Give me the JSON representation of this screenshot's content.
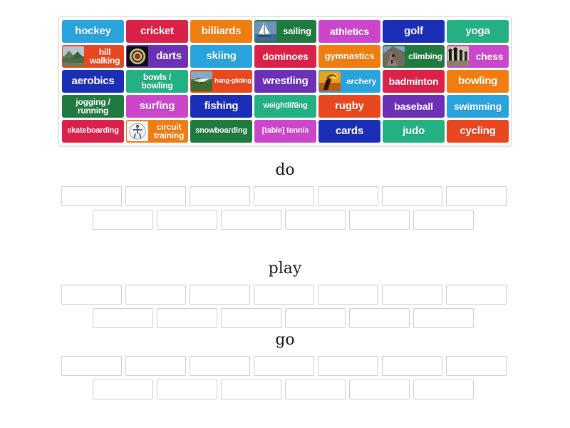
{
  "activity": {
    "type": "group-sort",
    "title_do": "do",
    "title_play": "play",
    "title_go": "go"
  },
  "tile_bank": {
    "rows": [
      [
        {
          "label": "hockey",
          "color": "#29a3dc",
          "size": "fs-15",
          "image": null
        },
        {
          "label": "cricket",
          "color": "#d9214a",
          "size": "fs-15",
          "image": null
        },
        {
          "label": "billiards",
          "color": "#f07d10",
          "size": "fs-15",
          "image": null
        },
        {
          "label": "sailing",
          "color": "#1f7a3f",
          "size": "fs-13",
          "image": "sailboat-photo"
        },
        {
          "label": "athletics",
          "color": "#cc46cc",
          "size": "fs-14",
          "image": null
        },
        {
          "label": "golf",
          "color": "#1a2fb5",
          "size": "fs-15",
          "image": null
        },
        {
          "label": "yoga",
          "color": "#23b082",
          "size": "fs-15",
          "image": null
        }
      ],
      [
        {
          "label": "hill walking",
          "color": "#e8471f",
          "size": "fs-12",
          "image": "hill-photo"
        },
        {
          "label": "darts",
          "color": "#6b30b5",
          "size": "fs-15",
          "image": "dartboard-photo"
        },
        {
          "label": "skiing",
          "color": "#29a3dc",
          "size": "fs-15",
          "image": null
        },
        {
          "label": "dominoes",
          "color": "#d9214a",
          "size": "fs-14",
          "image": null
        },
        {
          "label": "gymnastics",
          "color": "#f07d10",
          "size": "fs-13",
          "image": null
        },
        {
          "label": "climbing",
          "color": "#1f7a3f",
          "size": "fs-12",
          "image": "climber-photo"
        },
        {
          "label": "chess",
          "color": "#cc46cc",
          "size": "fs-14",
          "image": "chess-photo"
        }
      ],
      [
        {
          "label": "aerobics",
          "color": "#1a2fb5",
          "size": "fs-15",
          "image": null
        },
        {
          "label": "bowls / bowling",
          "color": "#23b082",
          "size": "fs-12",
          "image": null
        },
        {
          "label": "hang-gliding",
          "color": "#e8471f",
          "size": "fs-9",
          "image": "hangglider-photo"
        },
        {
          "label": "wrestling",
          "color": "#6b30b5",
          "size": "fs-15",
          "image": null
        },
        {
          "label": "archery",
          "color": "#29a3dc",
          "size": "fs-12",
          "image": "archery-photo"
        },
        {
          "label": "badminton",
          "color": "#d9214a",
          "size": "fs-14",
          "image": null
        },
        {
          "label": "bowling",
          "color": "#f07d10",
          "size": "fs-15",
          "image": null
        }
      ],
      [
        {
          "label": "jogging / running",
          "color": "#1f7a3f",
          "size": "fs-12",
          "image": null
        },
        {
          "label": "surfing",
          "color": "#cc46cc",
          "size": "fs-15",
          "image": null
        },
        {
          "label": "fishing",
          "color": "#1a2fb5",
          "size": "fs-15",
          "image": null
        },
        {
          "label": "weightlifting",
          "color": "#23b082",
          "size": "fs-11",
          "image": null
        },
        {
          "label": "rugby",
          "color": "#e8471f",
          "size": "fs-15",
          "image": null
        },
        {
          "label": "baseball",
          "color": "#6b30b5",
          "size": "fs-14",
          "image": null
        },
        {
          "label": "swimming",
          "color": "#29a3dc",
          "size": "fs-14",
          "image": null
        }
      ],
      [
        {
          "label": "skateboarding",
          "color": "#d9214a",
          "size": "fs-11",
          "image": null
        },
        {
          "label": "circuit training",
          "color": "#f07d10",
          "size": "fs-12",
          "image": "circuit-photo"
        },
        {
          "label": "snowboarding",
          "color": "#1f7a3f",
          "size": "fs-11",
          "image": null
        },
        {
          "label": "[table] tennis",
          "color": "#cc46cc",
          "size": "fs-11",
          "image": null
        },
        {
          "label": "cards",
          "color": "#1a2fb5",
          "size": "fs-15",
          "image": null
        },
        {
          "label": "judo",
          "color": "#23b082",
          "size": "fs-15",
          "image": null
        },
        {
          "label": "cycling",
          "color": "#e8471f",
          "size": "fs-15",
          "image": null
        }
      ]
    ]
  },
  "drop_groups": [
    {
      "title": "do",
      "row_a_count": 7,
      "row_b_count": 6
    },
    {
      "title": "play",
      "row_a_count": 7,
      "row_b_count": 6
    },
    {
      "title": "go",
      "row_a_count": 7,
      "row_b_count": 6
    }
  ],
  "colors": {
    "box_border": "#cfcfcf",
    "bank_border": "#d8d8d8",
    "page_background": "#ffffff",
    "title_text": "#1a1a1a",
    "tile_text": "#ffffff"
  }
}
